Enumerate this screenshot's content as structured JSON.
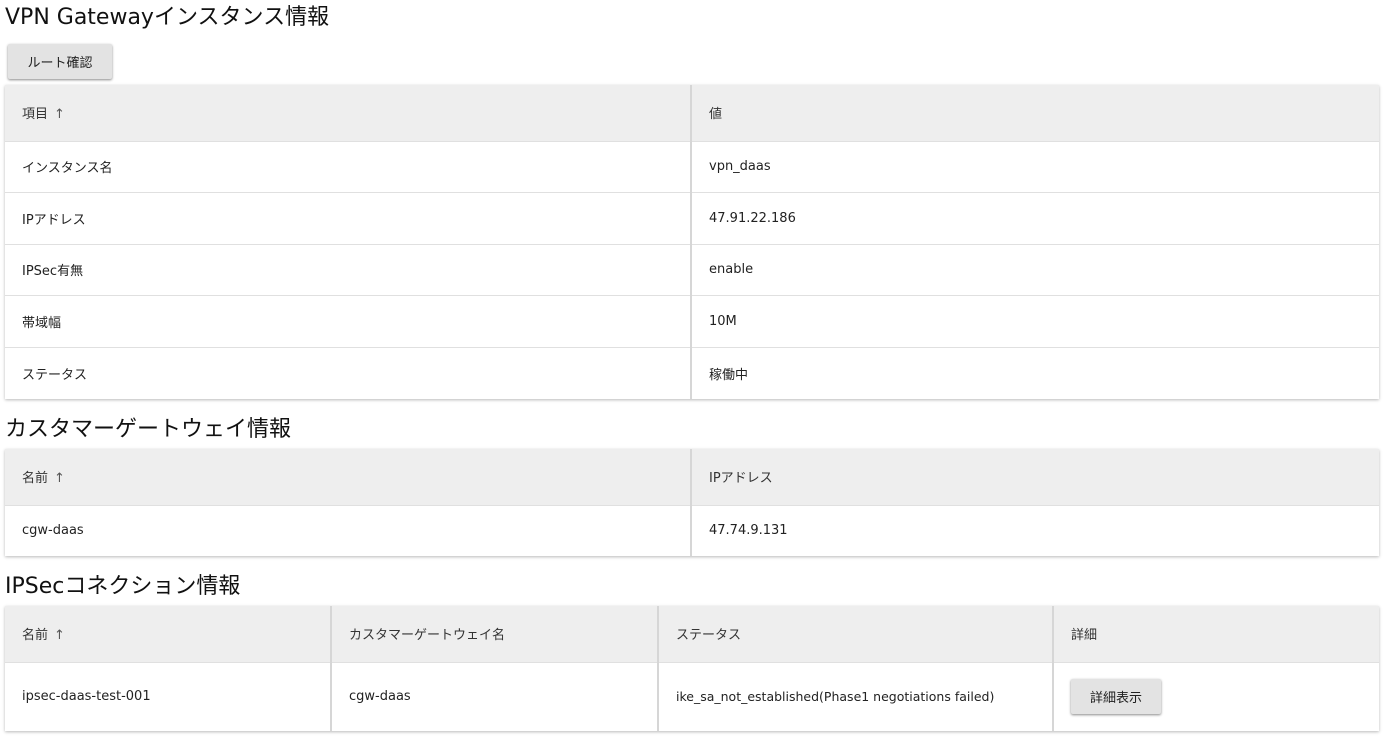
{
  "vpn_section": {
    "title": "VPN Gatewayインスタンス情報",
    "route_button": "ルート確認",
    "headers": {
      "item": "項目",
      "value": "値",
      "sort_icon": "↑"
    },
    "rows": [
      {
        "label": "インスタンス名",
        "value": "vpn_daas"
      },
      {
        "label": "IPアドレス",
        "value": "47.91.22.186"
      },
      {
        "label": "IPSec有無",
        "value": "enable"
      },
      {
        "label": "帯域幅",
        "value": "10M"
      },
      {
        "label": "ステータス",
        "value": "稼働中"
      }
    ],
    "status_color": "#4caf50"
  },
  "cgw_section": {
    "title": "カスタマーゲートウェイ情報",
    "headers": {
      "name": "名前",
      "ip": "IPアドレス",
      "sort_icon": "↑"
    },
    "rows": [
      {
        "name": "cgw-daas",
        "ip": "47.74.9.131"
      }
    ]
  },
  "ipsec_section": {
    "title": "IPSecコネクション情報",
    "headers": {
      "name": "名前",
      "cgw_name": "カスタマーゲートウェイ名",
      "status": "ステータス",
      "detail": "詳細",
      "sort_icon": "↑"
    },
    "rows": [
      {
        "name": "ipsec-daas-test-001",
        "cgw_name": "cgw-daas",
        "status": "ike_sa_not_established(Phase1 negotiations failed)",
        "detail_button": "詳細表示"
      }
    ],
    "status_color": "#d32f2f"
  }
}
